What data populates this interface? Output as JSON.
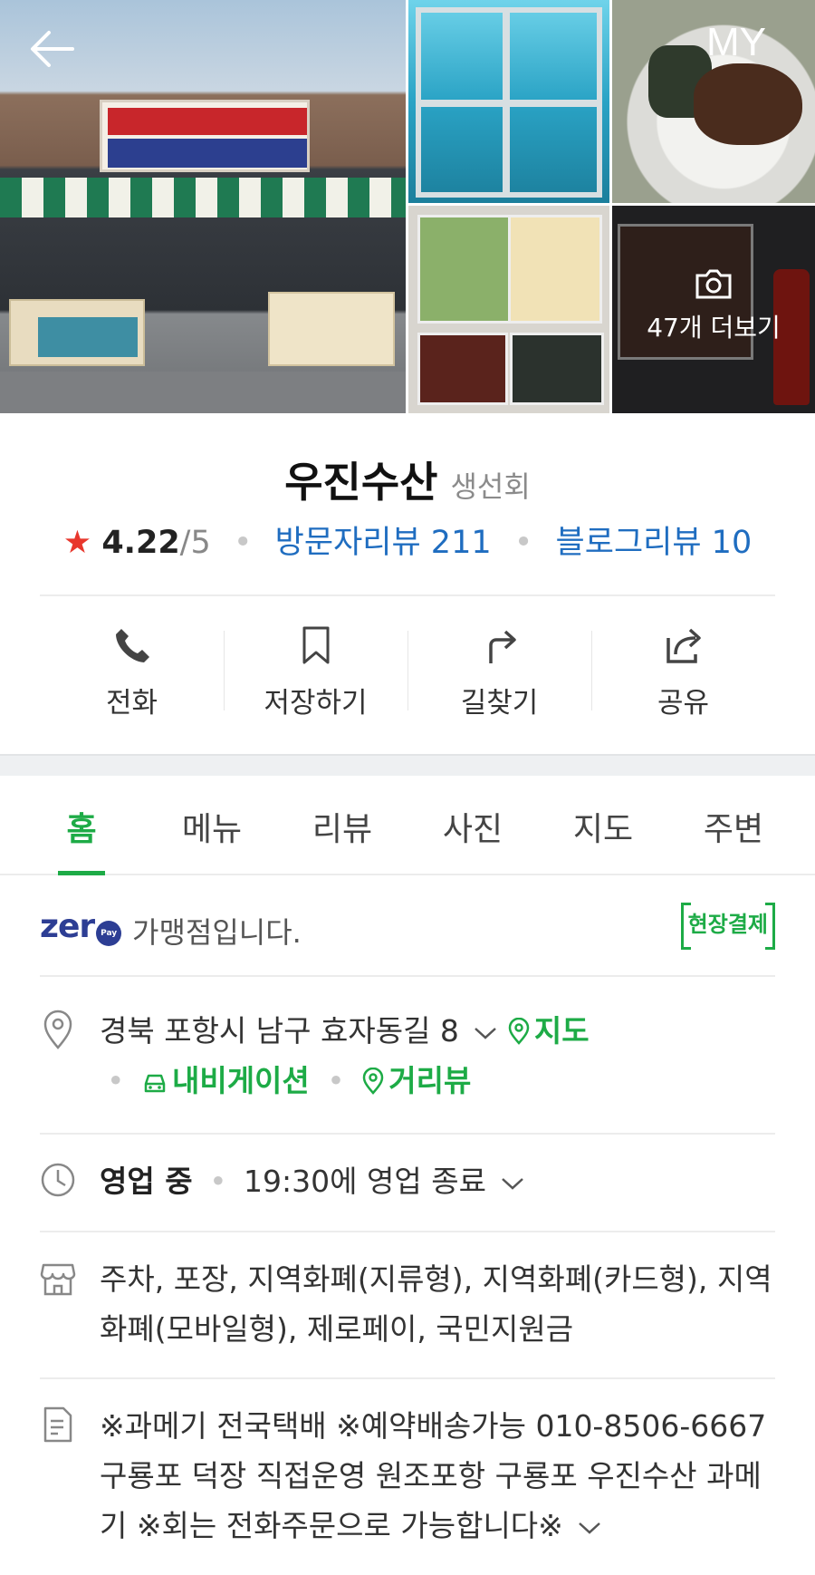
{
  "header": {
    "my_label": "MY",
    "more_photos": "47개 더보기"
  },
  "place": {
    "name": "우진수산",
    "category": "생선회",
    "rating": "4.22",
    "rating_max": "/5",
    "visitor_reviews": "방문자리뷰 211",
    "blog_reviews": "블로그리뷰 10"
  },
  "actions": [
    {
      "label": "전화",
      "icon": "phone-icon"
    },
    {
      "label": "저장하기",
      "icon": "bookmark-icon"
    },
    {
      "label": "길찾기",
      "icon": "directions-icon"
    },
    {
      "label": "공유",
      "icon": "share-icon"
    }
  ],
  "tabs": [
    "홈",
    "메뉴",
    "리뷰",
    "사진",
    "지도",
    "주변"
  ],
  "active_tab": "홈",
  "zeropay": {
    "logo": "zer",
    "logo_badge": "Pay",
    "text": "가맹점입니다.",
    "onsite_badge": "현장결제"
  },
  "address": {
    "text": "경북 포항시 남구 효자동길 8",
    "map_link": "지도",
    "navigation_link": "내비게이션",
    "streetview_link": "거리뷰"
  },
  "hours": {
    "status": "영업 중",
    "detail": "19:30에 영업 종료"
  },
  "facilities": {
    "text": "주차, 포장, 지역화폐(지류형), 지역화폐(카드형), 지역화폐(모바일형), 제로페이, 국민지원금"
  },
  "description": {
    "text": "※과메기 전국택배 ※예약배송가능 010-8506-6667 구룡포 덕장 직접운영 원조포항 구룡포 우진수산 과메기 ※회는 전화주문으로 가능합니다※"
  },
  "colors": {
    "accent_green": "#1dab46",
    "link_blue": "#1f6dc0",
    "star_red": "#e8372d",
    "zeropay_navy": "#2d3e94"
  }
}
